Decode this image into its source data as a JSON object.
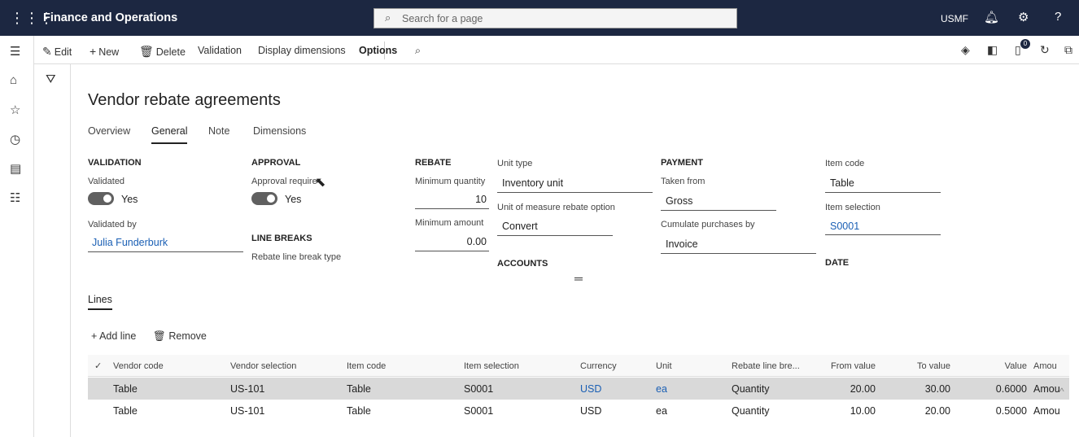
{
  "app": {
    "title": "Finance and Operations",
    "company": "USMF"
  },
  "search": {
    "placeholder": "Search for a page"
  },
  "topbar_icons": [
    "waffle-icon",
    "bell-icon",
    "gear-icon",
    "help-icon"
  ],
  "actions": {
    "edit": "Edit",
    "new": "New",
    "delete": "Delete",
    "validation": "Validation",
    "display_dimensions": "Display dimensions",
    "options": "Options",
    "notifications_count": "0"
  },
  "page": {
    "title": "Vendor rebate agreements",
    "tabs": [
      "Overview",
      "General",
      "Note",
      "Dimensions"
    ],
    "active_tab": "General"
  },
  "validation": {
    "heading": "VALIDATION",
    "validated_label": "Validated",
    "validated_value": "Yes",
    "validated_by_label": "Validated by",
    "validated_by_value": "Julia Funderburk"
  },
  "approval": {
    "heading": "APPROVAL",
    "approval_label": "Approval require",
    "approval_value": "Yes"
  },
  "line_breaks": {
    "heading": "LINE BREAKS",
    "type_label": "Rebate line break type"
  },
  "rebate": {
    "heading": "REBATE",
    "min_qty_label": "Minimum quantity",
    "min_qty_value": "10",
    "min_amount_label": "Minimum amount",
    "min_amount_value": "0.00",
    "unit_type_label": "Unit type",
    "unit_type_value": "Inventory unit",
    "uom_option_label": "Unit of measure rebate option",
    "uom_option_value": "Convert",
    "accounts_heading": "ACCOUNTS"
  },
  "payment": {
    "heading": "PAYMENT",
    "taken_from_label": "Taken from",
    "taken_from_value": "Gross",
    "cumulate_label": "Cumulate purchases by",
    "cumulate_value": "Invoice"
  },
  "item": {
    "item_code_label": "Item code",
    "item_code_value": "Table",
    "item_selection_label": "Item selection",
    "item_selection_value": "S0001",
    "date_heading": "DATE"
  },
  "lines": {
    "tab_label": "Lines",
    "add_line": "Add line",
    "remove": "Remove",
    "columns": [
      "Vendor code",
      "Vendor selection",
      "Item code",
      "Item selection",
      "Currency",
      "Unit",
      "Rebate line bre...",
      "From value",
      "To value",
      "Value",
      "Amou"
    ],
    "rows": [
      [
        "Table",
        "US-101",
        "Table",
        "S0001",
        "USD",
        "ea",
        "Quantity",
        "20.00",
        "30.00",
        "0.6000",
        "Amou"
      ],
      [
        "Table",
        "US-101",
        "Table",
        "S0001",
        "USD",
        "ea",
        "Quantity",
        "10.00",
        "20.00",
        "0.5000",
        "Amou"
      ]
    ]
  },
  "colors": {
    "nav_bg": "#1c2741",
    "link": "#1a5fb4",
    "selected_row": "#d9d9d9"
  }
}
